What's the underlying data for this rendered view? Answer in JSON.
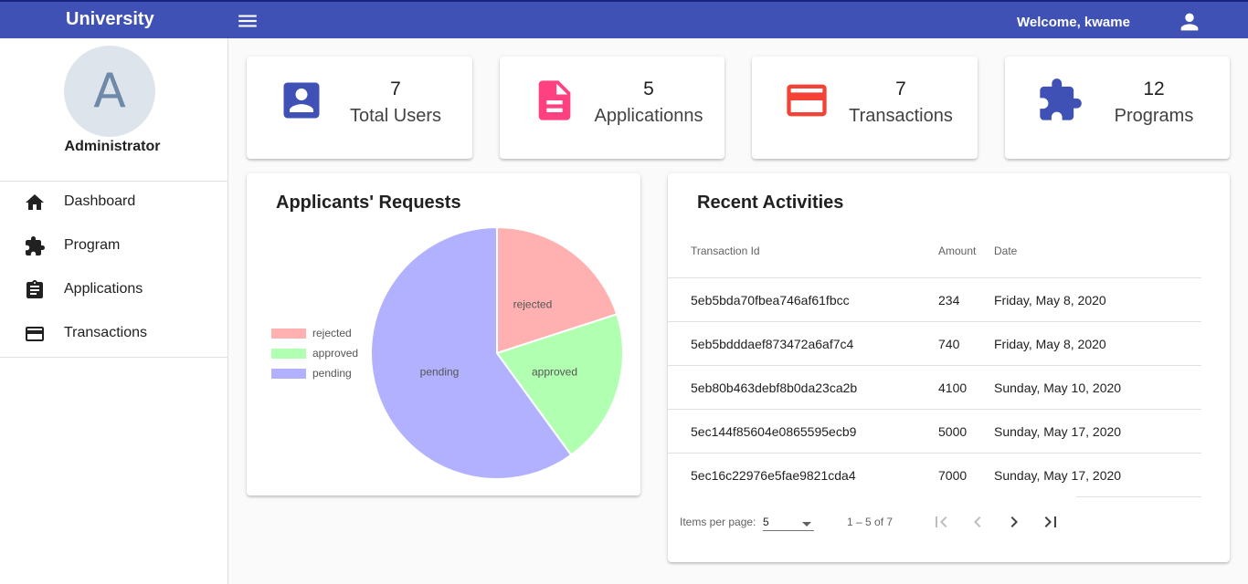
{
  "header": {
    "brand": "University",
    "welcome": "Welcome, kwame"
  },
  "profile": {
    "initial": "A",
    "role": "Administrator"
  },
  "nav": [
    {
      "label": "Dashboard",
      "icon": "home-icon"
    },
    {
      "label": "Program",
      "icon": "puzzle-icon"
    },
    {
      "label": "Applications",
      "icon": "clipboard-icon"
    },
    {
      "label": "Transactions",
      "icon": "credit-card-icon"
    }
  ],
  "stats": [
    {
      "value": "7",
      "label": "Total Users",
      "icon": "account-box-icon",
      "color": "#3f51b5"
    },
    {
      "value": "5",
      "label": "Applicationns",
      "icon": "document-icon",
      "color": "#ff4081"
    },
    {
      "value": "7",
      "label": "Transactions",
      "icon": "credit-card-icon",
      "color": "#f44336"
    },
    {
      "value": "12",
      "label": "Programs",
      "icon": "puzzle-icon",
      "color": "#3f51b5"
    }
  ],
  "requests": {
    "title": "Applicants' Requests"
  },
  "chart_data": {
    "type": "pie",
    "title": "Applicants' Requests",
    "legend_position": "left",
    "slices": [
      {
        "label": "rejected",
        "value": 1,
        "color": "#ffb1b1"
      },
      {
        "label": "approved",
        "value": 1,
        "color": "#b1ffb1"
      },
      {
        "label": "pending",
        "value": 3,
        "color": "#b1b1ff"
      }
    ]
  },
  "activities": {
    "title": "Recent Activities",
    "columns": [
      "Transaction Id",
      "Amount",
      "Date"
    ],
    "rows": [
      [
        "5eb5bda70fbea746af61fbcc",
        "234",
        "Friday, May 8, 2020"
      ],
      [
        "5eb5bdddaef873472a6af7c4",
        "740",
        "Friday, May 8, 2020"
      ],
      [
        "5eb80b463debf8b0da23ca2b",
        "4100",
        "Sunday, May 10, 2020"
      ],
      [
        "5ec144f85604e0865595ecb9",
        "5000",
        "Sunday, May 17, 2020"
      ],
      [
        "5ec16c22976e5fae9821cda4",
        "7000",
        "Sunday, May 17, 2020"
      ]
    ],
    "paginator": {
      "items_label": "Items per page:",
      "page_size": "5",
      "range": "1 – 5 of 7"
    }
  }
}
